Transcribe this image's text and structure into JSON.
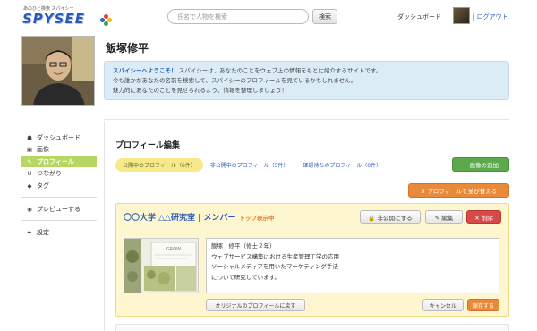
{
  "header": {
    "logo_tagline": "あのひと検索 スパイシー",
    "logo_text": "SPYSEE",
    "search_placeholder": "氏名で人物を検索",
    "search_button": "検索",
    "dashboard_link": "ダッシュボード",
    "logout_link": "| ログアウト",
    "logo_dot_colors": [
      "#e8452a",
      "#f5b820",
      "#3aa54a",
      "#2a6ab8"
    ]
  },
  "profile": {
    "name": "飯塚修平"
  },
  "welcome": {
    "title": "スパイシーへようこそ！",
    "line1": "スパイシーは、あなたのことをウェブ上の情報をもとに紹介するサイトです。",
    "line2": "今も誰かがあなたの名前を検索して、スパイシーのプロフィールを見ているかもしれません。",
    "line3": "魅力的にあなたのことを見せられるよう、情報を整理しましょう！"
  },
  "sidebar": {
    "items": [
      {
        "label": "ダッシュボード",
        "icon": "dashboard-icon",
        "glyph": "☗"
      },
      {
        "label": "画像",
        "icon": "image-icon",
        "glyph": "▣"
      },
      {
        "label": "プロフィール",
        "icon": "pencil-icon",
        "glyph": "✎"
      },
      {
        "label": "つながり",
        "icon": "magnet-icon",
        "glyph": "U"
      },
      {
        "label": "タグ",
        "icon": "tag-icon",
        "glyph": "◆"
      },
      {
        "label": "プレビューする",
        "icon": "eye-icon",
        "glyph": "◉"
      },
      {
        "label": "設定",
        "icon": "wrench-icon",
        "glyph": "✒"
      }
    ],
    "active_color": "#b6d863"
  },
  "main": {
    "section_title": "プロフィール編集",
    "tabs": [
      {
        "label": "公開中のプロフィール（6件）"
      },
      {
        "label": "非公開中のプロフィール（5件）"
      },
      {
        "label": "確認待ちのプロフィール（0件）"
      }
    ],
    "add_image_button": "+ 画像の追加",
    "sort_button": "⇕ プロフィールを並び替える"
  },
  "card": {
    "title": "〇〇大学 △△研究室 | メンバー",
    "top_mark": "トップ表示中",
    "private_button": "🔒 非公開にする",
    "edit_button": "✎ 編集",
    "delete_button": "✕ 削除",
    "thumb_label": "GROW",
    "text": "飯塚　修平（修士２年）\nウェブサービス構築における生産管理工学の応用\nソーシャルメディアを用いたマーケティング手法\nについて研究しています。",
    "revert_button": "オリジナルのプロフィールに戻す",
    "cancel_button": "キャンセル",
    "save_button": "保存する"
  },
  "colors": {
    "link_blue": "#2a5ab8",
    "orange": "#e88a3a",
    "green": "#5ba94a",
    "red": "#d84a4a",
    "welcome_bg": "#dcecf7",
    "card_bg": "#fdf6cf"
  }
}
